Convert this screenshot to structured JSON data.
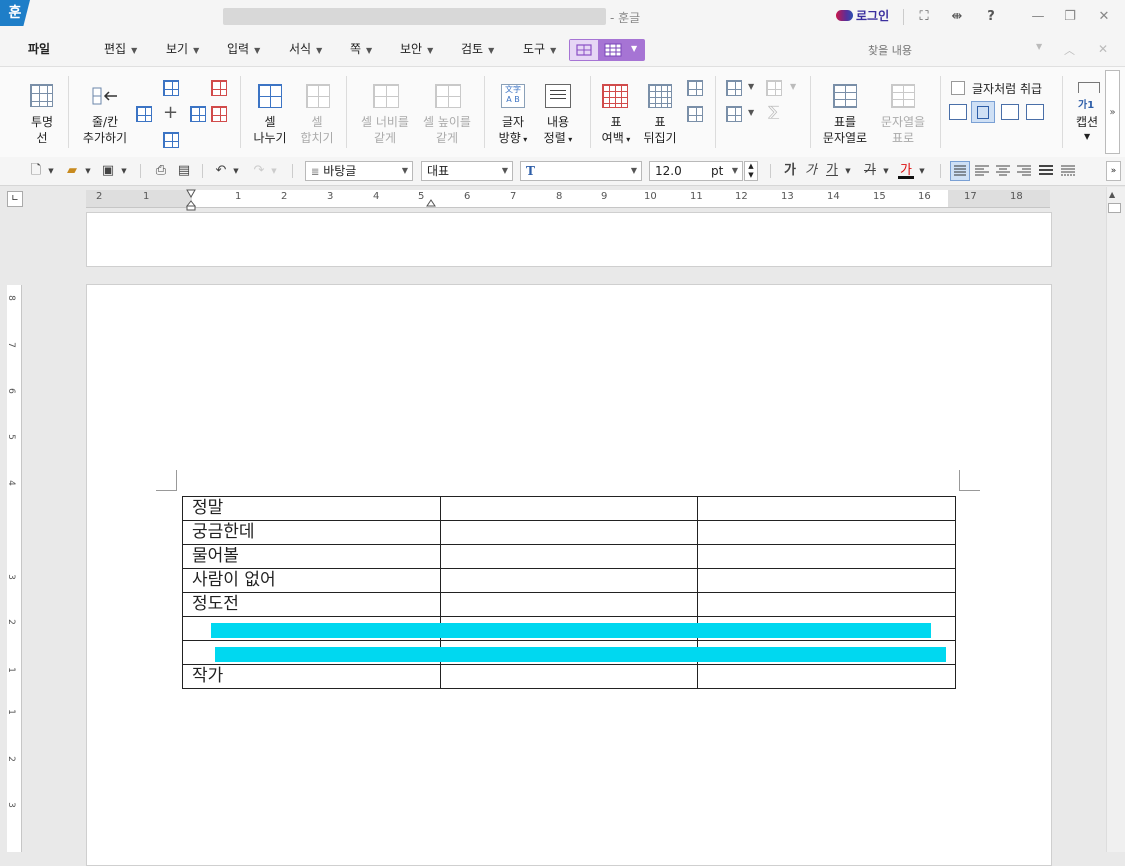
{
  "titlebar": {
    "app_name": "- 훈글",
    "logo_text": "훈",
    "login_label": "로그인",
    "buttons": [
      "⛶",
      "⇼",
      "?",
      "—",
      "❐",
      "✕"
    ]
  },
  "menu": {
    "file": "파일",
    "items": [
      "편집",
      "보기",
      "입력",
      "서식",
      "쪽",
      "보안",
      "검토",
      "도구"
    ],
    "find_placeholder": "찾을 내용"
  },
  "ribbon": {
    "transparent_line_1": "투명",
    "transparent_line_2": "선",
    "add_rowcol_1": "줄/칸",
    "add_rowcol_2": "추가하기",
    "split_cell_1": "셀",
    "split_cell_2": "나누기",
    "merge_cell_1": "셀",
    "merge_cell_2": "합치기",
    "equal_width_1": "셀 너비를",
    "equal_width_2": "같게",
    "equal_height_1": "셀 높이를",
    "equal_height_2": "같게",
    "text_dir_1": "글자",
    "text_dir_2": "방향",
    "content_align_1": "내용",
    "content_align_2": "정렬",
    "table_margin_1": "표",
    "table_margin_2": "여백",
    "table_flip_1": "표",
    "table_flip_2": "뒤집기",
    "table_to_text_1": "표를",
    "table_to_text_2": "문자열로",
    "text_to_table_1": "문자열을",
    "text_to_table_2": "표로",
    "treat_as_char": "글자처럼 취급",
    "caption_1": "가1",
    "caption_2": "캡션"
  },
  "format": {
    "style": "바탕글",
    "font_lang": "대표",
    "font": "",
    "size": "12.0",
    "unit": "pt",
    "bold": "가",
    "italic": "가",
    "underline": "가",
    "strike": "가",
    "color": "가"
  },
  "ruler": {
    "h_numbers": [
      "2",
      "1",
      "1",
      "2",
      "3",
      "4",
      "5",
      "6",
      "7",
      "8",
      "9",
      "10",
      "11",
      "12",
      "13",
      "14",
      "15",
      "16",
      "17",
      "18"
    ],
    "v_numbers": [
      "8",
      "7",
      "6",
      "5",
      "4",
      "3",
      "2",
      "1",
      "1",
      "2",
      "3"
    ]
  },
  "document": {
    "table_rows": [
      [
        "정말",
        "",
        ""
      ],
      [
        "궁금한데",
        "",
        ""
      ],
      [
        "물어볼",
        "",
        ""
      ],
      [
        "사람이 없어",
        "",
        ""
      ],
      [
        "정도전",
        "",
        ""
      ],
      [
        "",
        "",
        ""
      ],
      [
        "",
        "",
        ""
      ],
      [
        "작가",
        "",
        ""
      ]
    ]
  },
  "colors": {
    "accent_purple": "#a674d4",
    "highlight": "#00d8f0",
    "logo_blue": "#1e7ec8"
  }
}
